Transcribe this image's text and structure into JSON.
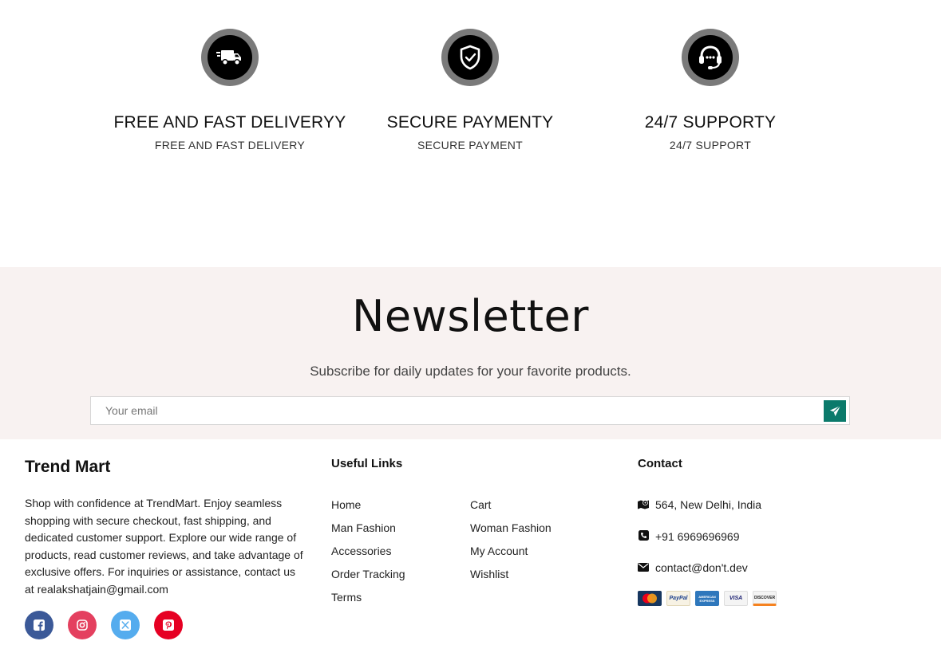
{
  "features": [
    {
      "icon": "truck-icon",
      "title": "FREE AND FAST DELIVERYY",
      "subtitle": "FREE AND FAST DELIVERY"
    },
    {
      "icon": "shield-check-icon",
      "title": "SECURE PAYMENTY",
      "subtitle": "SECURE PAYMENT"
    },
    {
      "icon": "headset-icon",
      "title": "24/7 SUPPORTY",
      "subtitle": "24/7 SUPPORT"
    }
  ],
  "newsletter": {
    "title": "Newsletter",
    "lead": "Subscribe for daily updates for your favorite products.",
    "email_placeholder": "Your email",
    "email_value": "",
    "submit_icon": "paper-plane-icon"
  },
  "footer": {
    "brand": "Trend Mart",
    "about": "Shop with confidence at TrendMart. Enjoy seamless shopping with secure checkout, fast shipping, and dedicated customer support. Explore our wide range of products, read customer reviews, and take advantage of exclusive offers. For inquiries or assistance, contact us at realakshatjain@gmail.com",
    "socials": [
      {
        "icon": "facebook-icon",
        "color": "#3b5998"
      },
      {
        "icon": "instagram-icon",
        "color": "#e4405f"
      },
      {
        "icon": "x-twitter-icon",
        "color": "#55acee"
      },
      {
        "icon": "pinterest-icon",
        "color": "#e60023"
      }
    ],
    "useful_links_title": "Useful Links",
    "links_col1": [
      "Home",
      "Man Fashion",
      "Accessories",
      "Order Tracking",
      "Terms"
    ],
    "links_col2": [
      "Cart",
      "Woman Fashion",
      "My Account",
      "Wishlist"
    ],
    "contact_title": "Contact",
    "contact": [
      {
        "icon": "map-icon",
        "text": "564, New Delhi, India"
      },
      {
        "icon": "phone-icon",
        "text": "+91 6969696969"
      },
      {
        "icon": "envelope-icon",
        "text": "contact@don't.dev"
      }
    ],
    "payments": [
      {
        "icon": "mastercard-icon",
        "label": "MasterCard"
      },
      {
        "icon": "paypal-icon",
        "label": "PayPal"
      },
      {
        "icon": "amex-icon",
        "label": "AMERICAN EXPRESS"
      },
      {
        "icon": "visa-icon",
        "label": "VISA"
      },
      {
        "icon": "discover-icon",
        "label": "DISCOVER"
      }
    ]
  },
  "colors": {
    "accent": "#0b7a6b",
    "newsletter_bg": "#f8f2f1"
  }
}
